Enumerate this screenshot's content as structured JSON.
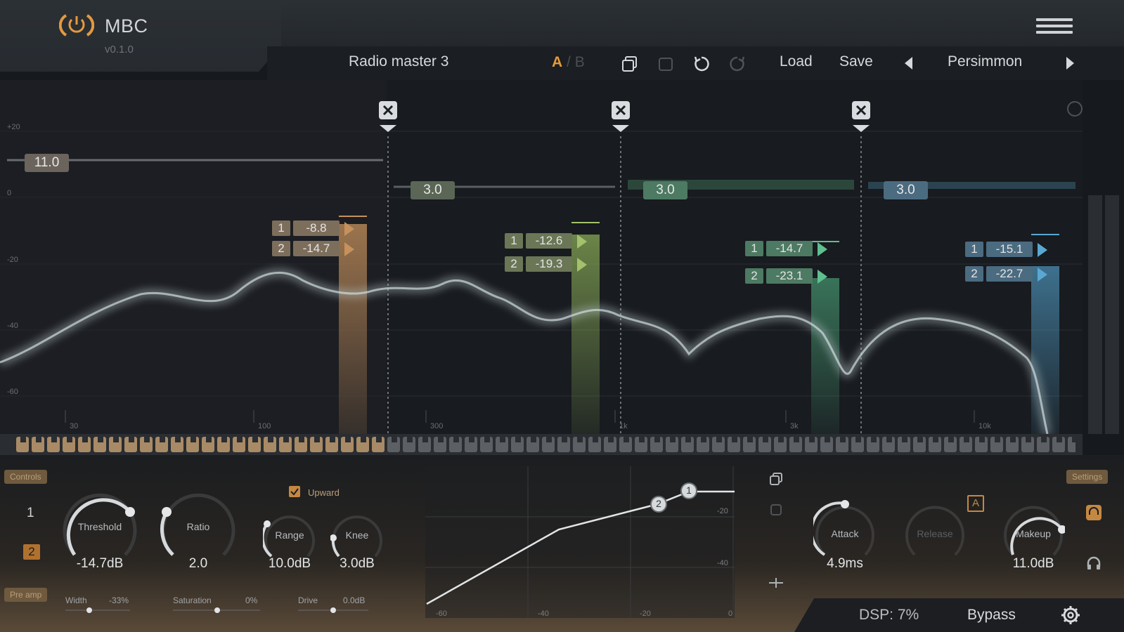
{
  "app": {
    "name": "MBC",
    "version": "v0.1.0"
  },
  "toolbar": {
    "preset": "Radio master 3",
    "a_label": "A",
    "separator": "/",
    "b_label": "B",
    "load_label": "Load",
    "save_label": "Save",
    "theme": "Persimmon"
  },
  "spectrum": {
    "db_labels": [
      "+20",
      "0",
      "-20",
      "-40",
      "-60"
    ],
    "freq_labels": [
      "30",
      "100",
      "300",
      "1k",
      "3k",
      "10k"
    ],
    "bands": [
      {
        "gain": "11.0",
        "thr1": "-8.8",
        "thr2": "-14.7",
        "color": "#c6915c"
      },
      {
        "gain": "3.0",
        "thr1": "-12.6",
        "thr2": "-19.3",
        "color": "#a3c26b"
      },
      {
        "gain": "3.0",
        "thr1": "-14.7",
        "thr2": "-23.1",
        "color": "#5fbf8f"
      },
      {
        "gain": "3.0",
        "thr1": "-15.1",
        "thr2": "-22.7",
        "color": "#5aa8d2"
      }
    ],
    "threshold_index": [
      "1",
      "2"
    ]
  },
  "panel": {
    "tags": {
      "left": "Controls",
      "settings": "Settings",
      "pre_amp": "Pre amp"
    },
    "threshold_index": {
      "one": "1",
      "two": "2"
    },
    "upward_label": "Upward",
    "knobs": {
      "threshold": {
        "label": "Threshold",
        "value": "-14.7dB"
      },
      "ratio": {
        "label": "Ratio",
        "value": "2.0"
      },
      "range": {
        "label": "Range",
        "value": "10.0dB"
      },
      "knee": {
        "label": "Knee",
        "value": "3.0dB"
      },
      "attack": {
        "label": "Attack",
        "value": "4.9ms"
      },
      "release": {
        "label": "Release",
        "value": ""
      },
      "makeup": {
        "label": "Makeup",
        "value": "11.0dB"
      }
    },
    "sliders": {
      "width": {
        "label": "Width",
        "value": "-33%"
      },
      "saturation": {
        "label": "Saturation",
        "value": "0%"
      },
      "drive": {
        "label": "Drive",
        "value": "0.0dB"
      }
    },
    "transfer": {
      "y_labels": [
        "-20",
        "-40"
      ],
      "x_labels": [
        "-60",
        "-40",
        "-20",
        "0"
      ],
      "points": [
        "1",
        "2"
      ]
    },
    "auto_label": "A"
  },
  "status": {
    "dsp": "DSP: 7%",
    "bypass": "Bypass"
  },
  "colors": {
    "accent": "#e59a3d"
  }
}
